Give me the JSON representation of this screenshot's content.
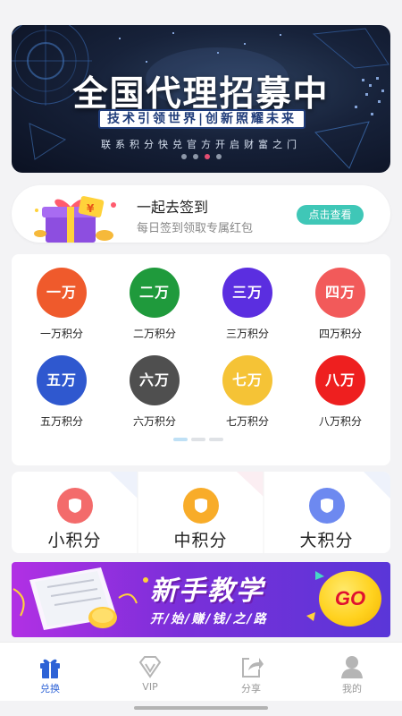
{
  "banner": {
    "title": "全国代理招募中",
    "subtitle": "技术引领世界|创新照耀未来",
    "tagline": "联系积分快兑官方开启财富之门",
    "dots": [
      false,
      false,
      true,
      false
    ]
  },
  "signin": {
    "title": "一起去签到",
    "desc": "每日签到领取专属红包",
    "button": "点击查看"
  },
  "points": [
    {
      "circle": "一万",
      "label": "一万积分",
      "color": "#ef5a2c"
    },
    {
      "circle": "二万",
      "label": "二万积分",
      "color": "#1f9a3c"
    },
    {
      "circle": "三万",
      "label": "三万积分",
      "color": "#5b2ee0"
    },
    {
      "circle": "四万",
      "label": "四万积分",
      "color": "#f25a5a"
    },
    {
      "circle": "五万",
      "label": "五万积分",
      "color": "#2f58cf"
    },
    {
      "circle": "六万",
      "label": "六万积分",
      "color": "#4f4f4f"
    },
    {
      "circle": "七万",
      "label": "七万积分",
      "color": "#f5c336"
    },
    {
      "circle": "八万",
      "label": "八万积分",
      "color": "#ee1f1f"
    }
  ],
  "levels": [
    {
      "label": "小积分",
      "color": "#f36b6b"
    },
    {
      "label": "中积分",
      "color": "#f8ac29"
    },
    {
      "label": "大积分",
      "color": "#6d89f0"
    }
  ],
  "tutorial": {
    "title": "新手教学",
    "subtitle": "开/始/赚/钱/之/路",
    "go": "GO"
  },
  "nav": [
    {
      "label": "兑换",
      "icon": "gift-icon",
      "active": true
    },
    {
      "label": "VIP",
      "icon": "vip-diamond-icon",
      "active": false
    },
    {
      "label": "分享",
      "icon": "share-icon",
      "active": false
    },
    {
      "label": "我的",
      "icon": "user-icon",
      "active": false
    }
  ],
  "colors": {
    "accent": "#2d62d6",
    "signin_button": "#3fc7b7",
    "active_dot": "#e44d72"
  }
}
